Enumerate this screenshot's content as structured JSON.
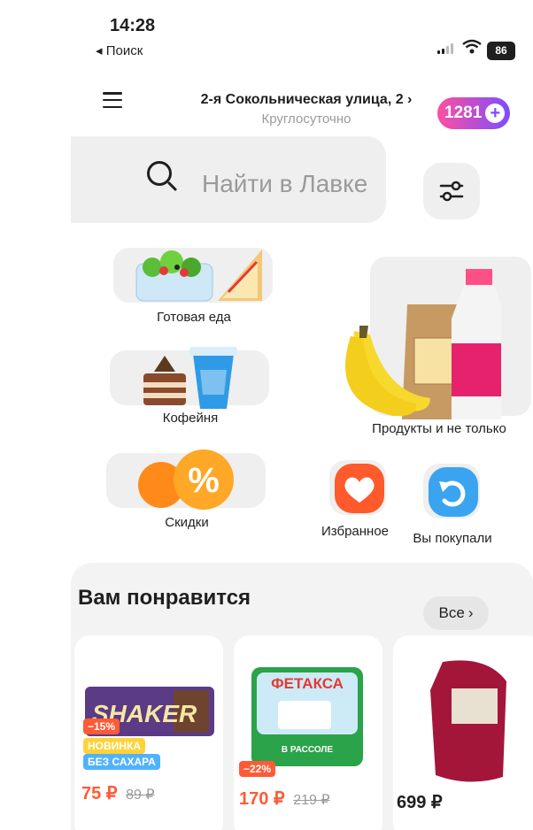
{
  "status_bar": {
    "time": "14:28",
    "back_label": "◂ Поиск",
    "battery": "86"
  },
  "header": {
    "address": "2-я Сокольническая улица, 2 ›",
    "hours": "Круглосуточно",
    "points": "1281"
  },
  "search": {
    "placeholder": "Найти в Лавке"
  },
  "categories": [
    {
      "label": "Готовая еда"
    },
    {
      "label": "Кофейня"
    },
    {
      "label": "Продукты и не только"
    },
    {
      "label": "Скидки"
    },
    {
      "label": "Избранное"
    },
    {
      "label": "Вы покупали"
    }
  ],
  "recommend": {
    "title": "Вам понравится",
    "all_label": "Все",
    "products": [
      {
        "discount": "−15%",
        "badges": [
          "НОВИНКА",
          "БЕЗ САХАРА"
        ],
        "price": "75 ₽",
        "old_price": "89 ₽",
        "brand": "SHAKER"
      },
      {
        "discount": "−22%",
        "price": "170 ₽",
        "old_price": "219 ₽",
        "brand": "ФЕТАКСА",
        "sub_label": "В РАССОЛЕ"
      },
      {
        "price": "699 ₽"
      }
    ]
  },
  "colors": {
    "accent_pink": "#ff4fa0",
    "accent_purple": "#7b4dff",
    "discount_red": "#ff5a36",
    "badge_yellow": "#ffd338",
    "badge_blue": "#4fb2ff"
  }
}
